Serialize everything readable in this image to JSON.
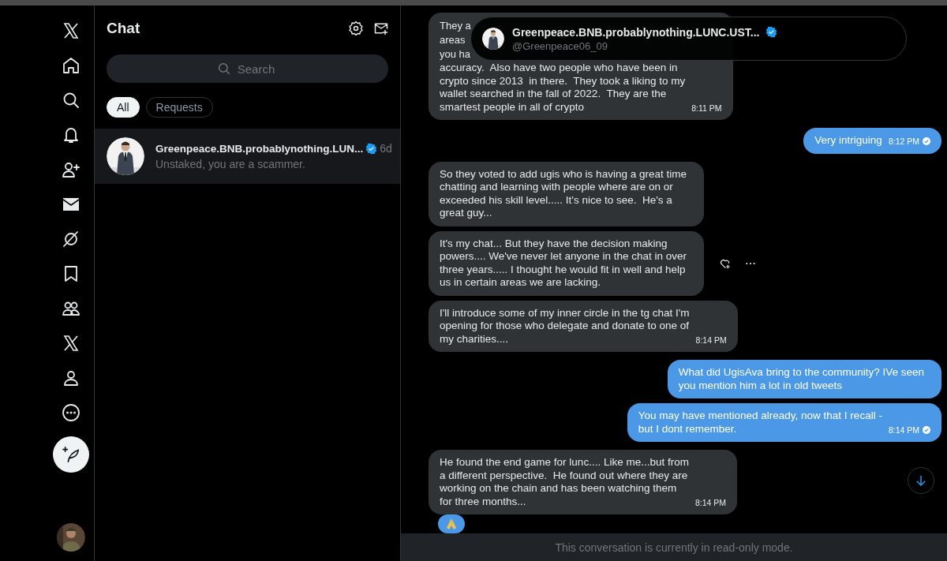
{
  "chat_list": {
    "title": "Chat",
    "search": {
      "placeholder": "Search"
    },
    "filters": [
      {
        "label": "All",
        "selected": true
      },
      {
        "label": "Requests",
        "selected": false
      }
    ],
    "conversations": [
      {
        "name": "Greenpeace.BNB.probablynothing.LUN...",
        "verified": true,
        "time": "6d",
        "preview": "Unstaked, you are a scammer.",
        "selected": true
      }
    ]
  },
  "conversation": {
    "header": {
      "name": "Greenpeace.BNB.probablynothing.LUNC.UST...",
      "handle": "@Greenpeace06_09",
      "verified": true
    },
    "messages": [
      {
        "kind": "received",
        "fragments": [
          "They a",
          "areas",
          "you ha"
        ],
        "lines": [
          "accuracy.  Also have two people who have been in",
          "crypto since 2013  in there.  They took a liking to my",
          "wallet searched in the fall of 2022.  They are the",
          "smartest people in all of crypto"
        ],
        "time": "8:11 PM"
      },
      {
        "kind": "sent",
        "lines": [
          "Very intriguing"
        ],
        "time": "8:12 PM",
        "read": true
      },
      {
        "kind": "received",
        "lines": [
          "So they voted to add ugis who is having a great time",
          "chatting and learning with people where are on or",
          "exceeded his skill level..... It's nice to see.  He's a",
          "great guy..."
        ]
      },
      {
        "kind": "received",
        "lines": [
          "It's my chat... But they have the decision making",
          "powers.... We've never let anyone in the chat in over",
          "three years..... I thought he would fit in well and help",
          "us in certain areas we are lacking."
        ],
        "actions_visible": true
      },
      {
        "kind": "received",
        "lines": [
          "I'll introduce some of my inner circle in the tg chat I'm",
          "opening for those who delegate and donate to one of",
          "my charities...."
        ],
        "time": "8:14 PM"
      },
      {
        "kind": "sent",
        "lines": [
          "What did UgisAva bring to the community? IVe seen",
          "you mention him a lot in old tweets"
        ]
      },
      {
        "kind": "sent",
        "lines": [
          "You may have mentioned already, now that I recall -",
          "but I dont remember."
        ],
        "time": "8:14 PM",
        "read": true
      },
      {
        "kind": "received",
        "lines": [
          "He found the end game for lunc.... Like me...but from",
          "a different perspective.  He found out where they are",
          "working on the chain and has been watching them",
          "for three months..."
        ],
        "time": "8:14 PM",
        "reaction": true
      }
    ],
    "footer": "This conversation is currently in read-only mode."
  }
}
